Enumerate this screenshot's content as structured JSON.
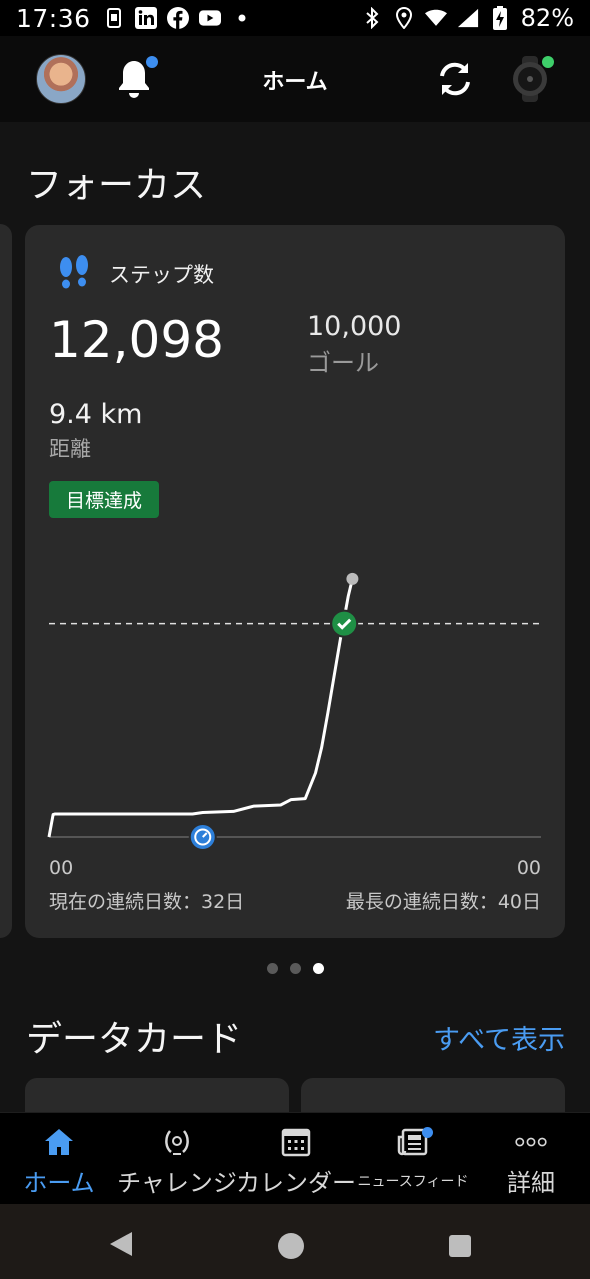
{
  "status_bar": {
    "time": "17:36",
    "battery_percent": "82%",
    "left_icons": [
      "sim-icon",
      "linkedin-icon",
      "facebook-icon",
      "youtube-icon",
      "dot-icon"
    ],
    "right_icons": [
      "bluetooth-icon",
      "location-icon",
      "wifi-icon",
      "signal-icon",
      "battery-charging-icon"
    ]
  },
  "app_bar": {
    "title": "ホーム",
    "notification_badge_color": "#3d8ef0",
    "device_badge_color": "#3ecf6a"
  },
  "focus": {
    "section_title": "フォーカス",
    "card": {
      "label": "ステップ数",
      "steps": "12,098",
      "goal_value": "10,000",
      "goal_label": "ゴール",
      "distance_value": "9.4 km",
      "distance_label": "距離",
      "badge": "目標達成",
      "badge_color": "#177a3b",
      "axis_start": "00",
      "axis_end": "00",
      "current_streak": "現在の連続日数：32日",
      "longest_streak": "最長の連続日数：40日"
    },
    "pager": {
      "count": 3,
      "active_index": 2
    }
  },
  "chart_data": {
    "type": "line",
    "title": "",
    "xlabel": "",
    "ylabel": "",
    "x_tick_labels": [
      "00",
      "00"
    ],
    "xlim": [
      0,
      24
    ],
    "ylim": [
      0,
      13500
    ],
    "goal_line": 10000,
    "goal_marker_x": 14.4,
    "event_marker_x": 7.5,
    "series": [
      {
        "x": [
          0,
          0.2,
          0.3,
          7.0,
          7.5,
          9.0,
          9.8,
          10.0,
          11.3,
          11.8,
          12.5,
          13.0,
          13.3,
          13.6,
          13.9,
          14.2,
          14.6,
          14.8
        ],
        "y": [
          0,
          1050,
          1080,
          1080,
          1150,
          1200,
          1400,
          1450,
          1500,
          1750,
          1800,
          3000,
          4200,
          5800,
          7500,
          9200,
          11300,
          12098
        ]
      }
    ]
  },
  "data_cards": {
    "section_title": "データカード",
    "see_all": "すべて表示"
  },
  "bottom_nav": [
    {
      "label": "ホーム",
      "icon": "home-icon",
      "active": true
    },
    {
      "label": "チャレンジ",
      "icon": "laurel-icon",
      "active": false
    },
    {
      "label": "カレンダー",
      "icon": "calendar-icon",
      "active": false
    },
    {
      "label": "ニュースフィード",
      "icon": "newsfeed-icon",
      "active": false
    },
    {
      "label": "詳細",
      "icon": "more-icon",
      "active": false
    }
  ],
  "accent_color": "#4a9cf2"
}
